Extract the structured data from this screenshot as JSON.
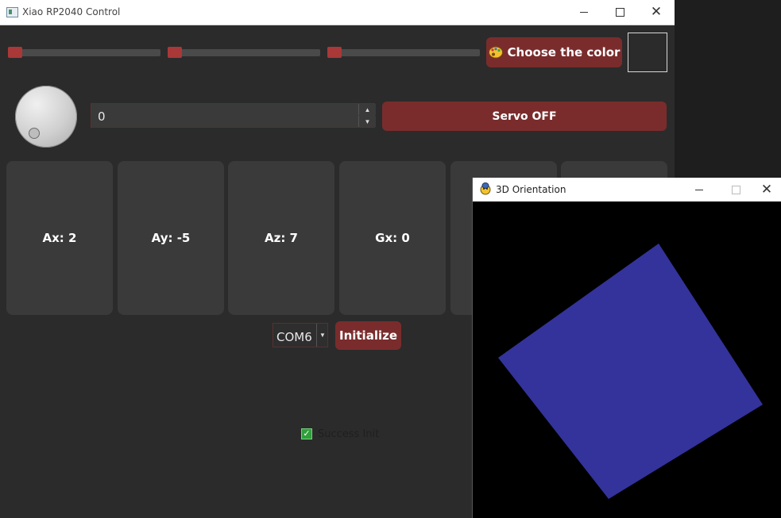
{
  "main_window": {
    "title": "Xiao RP2040 Control",
    "color_button_label": "Choose the color",
    "color_preview": "#2b2b2b",
    "sliders": [
      {
        "name": "red",
        "value_fraction": 0.0
      },
      {
        "name": "green",
        "value_fraction": 0.0
      },
      {
        "name": "blue",
        "value_fraction": 0.0
      }
    ],
    "spin_value": "0",
    "servo_button_label": "Servo OFF",
    "cards": [
      "Ax: 2",
      "Ay: -5",
      "Az: 7",
      "Gx: 0",
      "",
      ""
    ],
    "com_port": "COM6",
    "init_button_label": "Initialize",
    "status_checkbox_label": "Success Init",
    "status_checked": true
  },
  "orientation_window": {
    "title": "3D Orientation",
    "shape_color": "#33339b",
    "shape_rotation_deg": 55
  },
  "colors": {
    "accent_red": "#7a2c2c",
    "slider_handle": "#a93838",
    "panel_bg": "#2b2b2b",
    "card_bg": "#3a3a3a"
  },
  "icons": {
    "app": "window-icon",
    "color_button": "palette-icon",
    "orientation_app": "pygame-snake-icon"
  }
}
